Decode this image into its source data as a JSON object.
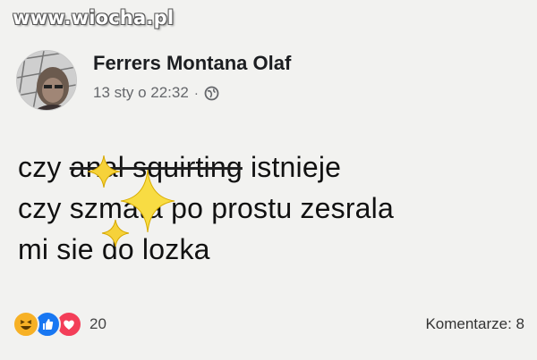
{
  "watermark": "www.wiocha.pl",
  "post": {
    "author": "Ferrers Montana Olaf",
    "timestamp": "13 sty o 22:32",
    "separator": "·",
    "privacy_icon": "globe-icon",
    "text_lines": [
      {
        "before": "czy ",
        "struck": "anal squirting",
        "after": " istnieje"
      },
      {
        "text": "czy szmata po prostu zesrala"
      },
      {
        "text": "mi sie do lozka"
      }
    ],
    "reactions": {
      "icons": [
        "haha-icon",
        "like-icon",
        "love-icon"
      ],
      "count": "20"
    },
    "comments_label": "Komentarze: 8"
  },
  "colors": {
    "background": "#f2f2f0",
    "like": "#1877f2",
    "love": "#f33e58",
    "haha": "#f7b125",
    "sparkle": "#f6d23a"
  }
}
